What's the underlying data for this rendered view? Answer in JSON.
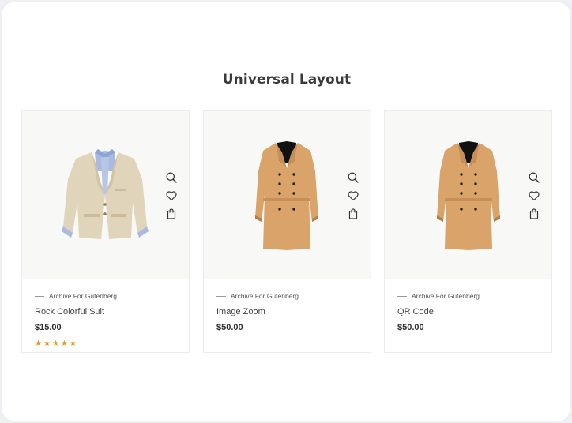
{
  "section": {
    "title": "Universal Layout"
  },
  "icons": {
    "quick_view": "search-icon",
    "wishlist": "heart-icon",
    "add_to_cart": "shopping-bag-icon"
  },
  "colors": {
    "star": "#e29a1c",
    "media_bg": "#f8f8f6",
    "title": "#3a3a3a"
  },
  "products": [
    {
      "category": "Archive For Gutenberg",
      "name": "Rock Colorful Suit",
      "price": "$15.00",
      "rating": 5,
      "image": "beige-blazer"
    },
    {
      "category": "Archive For Gutenberg",
      "name": "Image Zoom",
      "price": "$50.00",
      "image": "camel-trench-coat"
    },
    {
      "category": "Archive For Gutenberg",
      "name": "QR Code",
      "price": "$50.00",
      "image": "camel-trench-coat"
    }
  ]
}
